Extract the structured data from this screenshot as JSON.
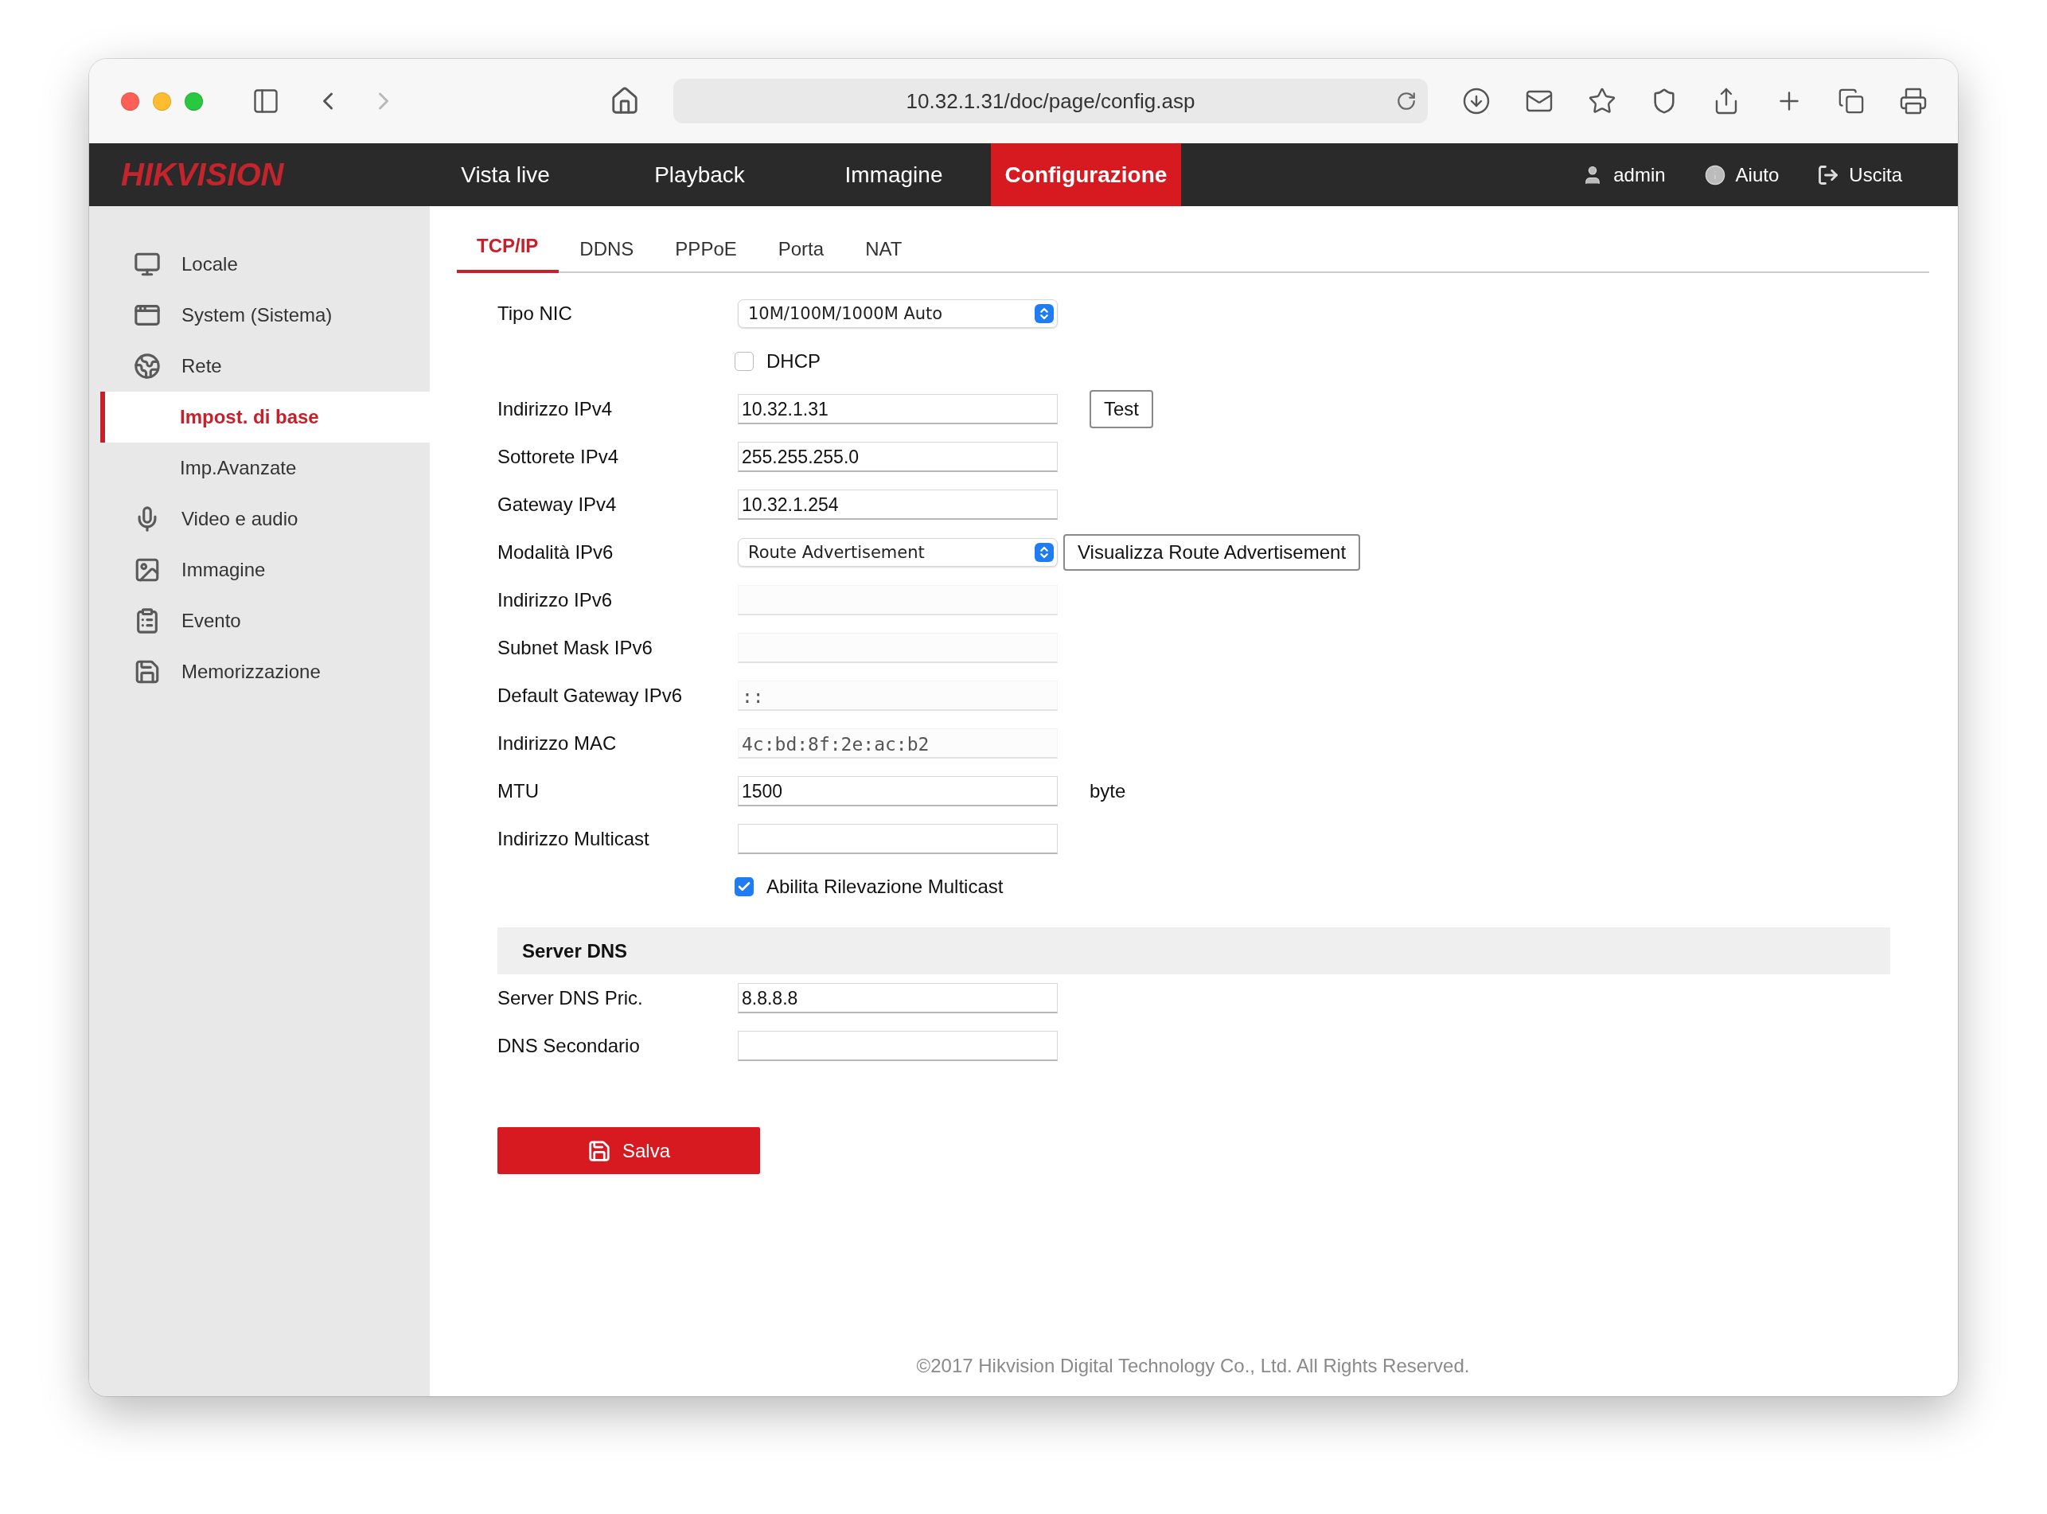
{
  "browser": {
    "url": "10.32.1.31/doc/page/config.asp"
  },
  "nav": {
    "logo": "HIKVISION",
    "items": [
      {
        "label": "Vista live",
        "selected": false
      },
      {
        "label": "Playback",
        "selected": false
      },
      {
        "label": "Immagine",
        "selected": false
      },
      {
        "label": "Configurazione",
        "selected": true
      }
    ],
    "user_links": [
      {
        "kind": "user",
        "label": "admin"
      },
      {
        "kind": "help",
        "label": "Aiuto"
      },
      {
        "kind": "logout",
        "label": "Uscita"
      }
    ]
  },
  "sidebar": {
    "items": [
      {
        "kind": "monitor",
        "label": "Locale",
        "selected": false
      },
      {
        "kind": "window",
        "label": "System (Sistema)",
        "selected": false
      },
      {
        "kind": "globe",
        "label": "Rete",
        "selected": false,
        "children": [
          {
            "label": "Impost. di base",
            "selected": true
          },
          {
            "label": "Imp.Avanzate",
            "selected": false
          }
        ]
      },
      {
        "kind": "media",
        "label": "Video e audio",
        "selected": false
      },
      {
        "kind": "image",
        "label": "Immagine",
        "selected": false
      },
      {
        "kind": "event",
        "label": "Evento",
        "selected": false
      },
      {
        "kind": "storage",
        "label": "Memorizzazione",
        "selected": false
      }
    ]
  },
  "tabs": [
    {
      "label": "TCP/IP",
      "selected": true
    },
    {
      "label": "DDNS",
      "selected": false
    },
    {
      "label": "PPPoE",
      "selected": false
    },
    {
      "label": "Porta",
      "selected": false
    },
    {
      "label": "NAT",
      "selected": false
    }
  ],
  "form": {
    "rows": [
      {
        "kind": "select",
        "label": "Tipo NIC",
        "value": "10M/100M/1000M Auto"
      },
      {
        "kind": "checkbox",
        "label": "DHCP",
        "checked": false
      },
      {
        "kind": "input",
        "label": "Indirizzo IPv4",
        "value": "10.32.1.31",
        "disabled": false,
        "button": "Test"
      },
      {
        "kind": "input",
        "label": "Sottorete IPv4",
        "value": "255.255.255.0",
        "disabled": false
      },
      {
        "kind": "input",
        "label": "Gateway IPv4",
        "value": "10.32.1.254",
        "disabled": false
      },
      {
        "kind": "select",
        "label": "Modalità IPv6",
        "value": "Route Advertisement",
        "button": "Visualizza Route Advertisement"
      },
      {
        "kind": "input",
        "label": "Indirizzo IPv6",
        "disabled": true
      },
      {
        "kind": "input",
        "label": "Subnet Mask IPv6",
        "disabled": true
      },
      {
        "kind": "input",
        "label": "Default Gateway IPv6",
        "value": "::",
        "disabled": true
      },
      {
        "kind": "input",
        "label": "Indirizzo MAC",
        "value": "4c:bd:8f:2e:ac:b2",
        "disabled": true
      },
      {
        "kind": "input",
        "label": "MTU",
        "value": "1500",
        "disabled": false,
        "unit": "byte"
      },
      {
        "kind": "input",
        "label": "Indirizzo Multicast",
        "disabled": false
      },
      {
        "kind": "checkbox",
        "label": "Abilita Rilevazione Multicast",
        "checked": true
      }
    ]
  },
  "dns": {
    "title": "Server DNS",
    "rows": [
      {
        "kind": "input",
        "label": "Server DNS Pric.",
        "value": "8.8.8.8",
        "disabled": false
      },
      {
        "kind": "input",
        "label": "DNS Secondario",
        "disabled": false
      }
    ]
  },
  "save_button": "Salva",
  "footer": "©2017 Hikvision Digital Technology Co., Ltd. All Rights Reserved."
}
